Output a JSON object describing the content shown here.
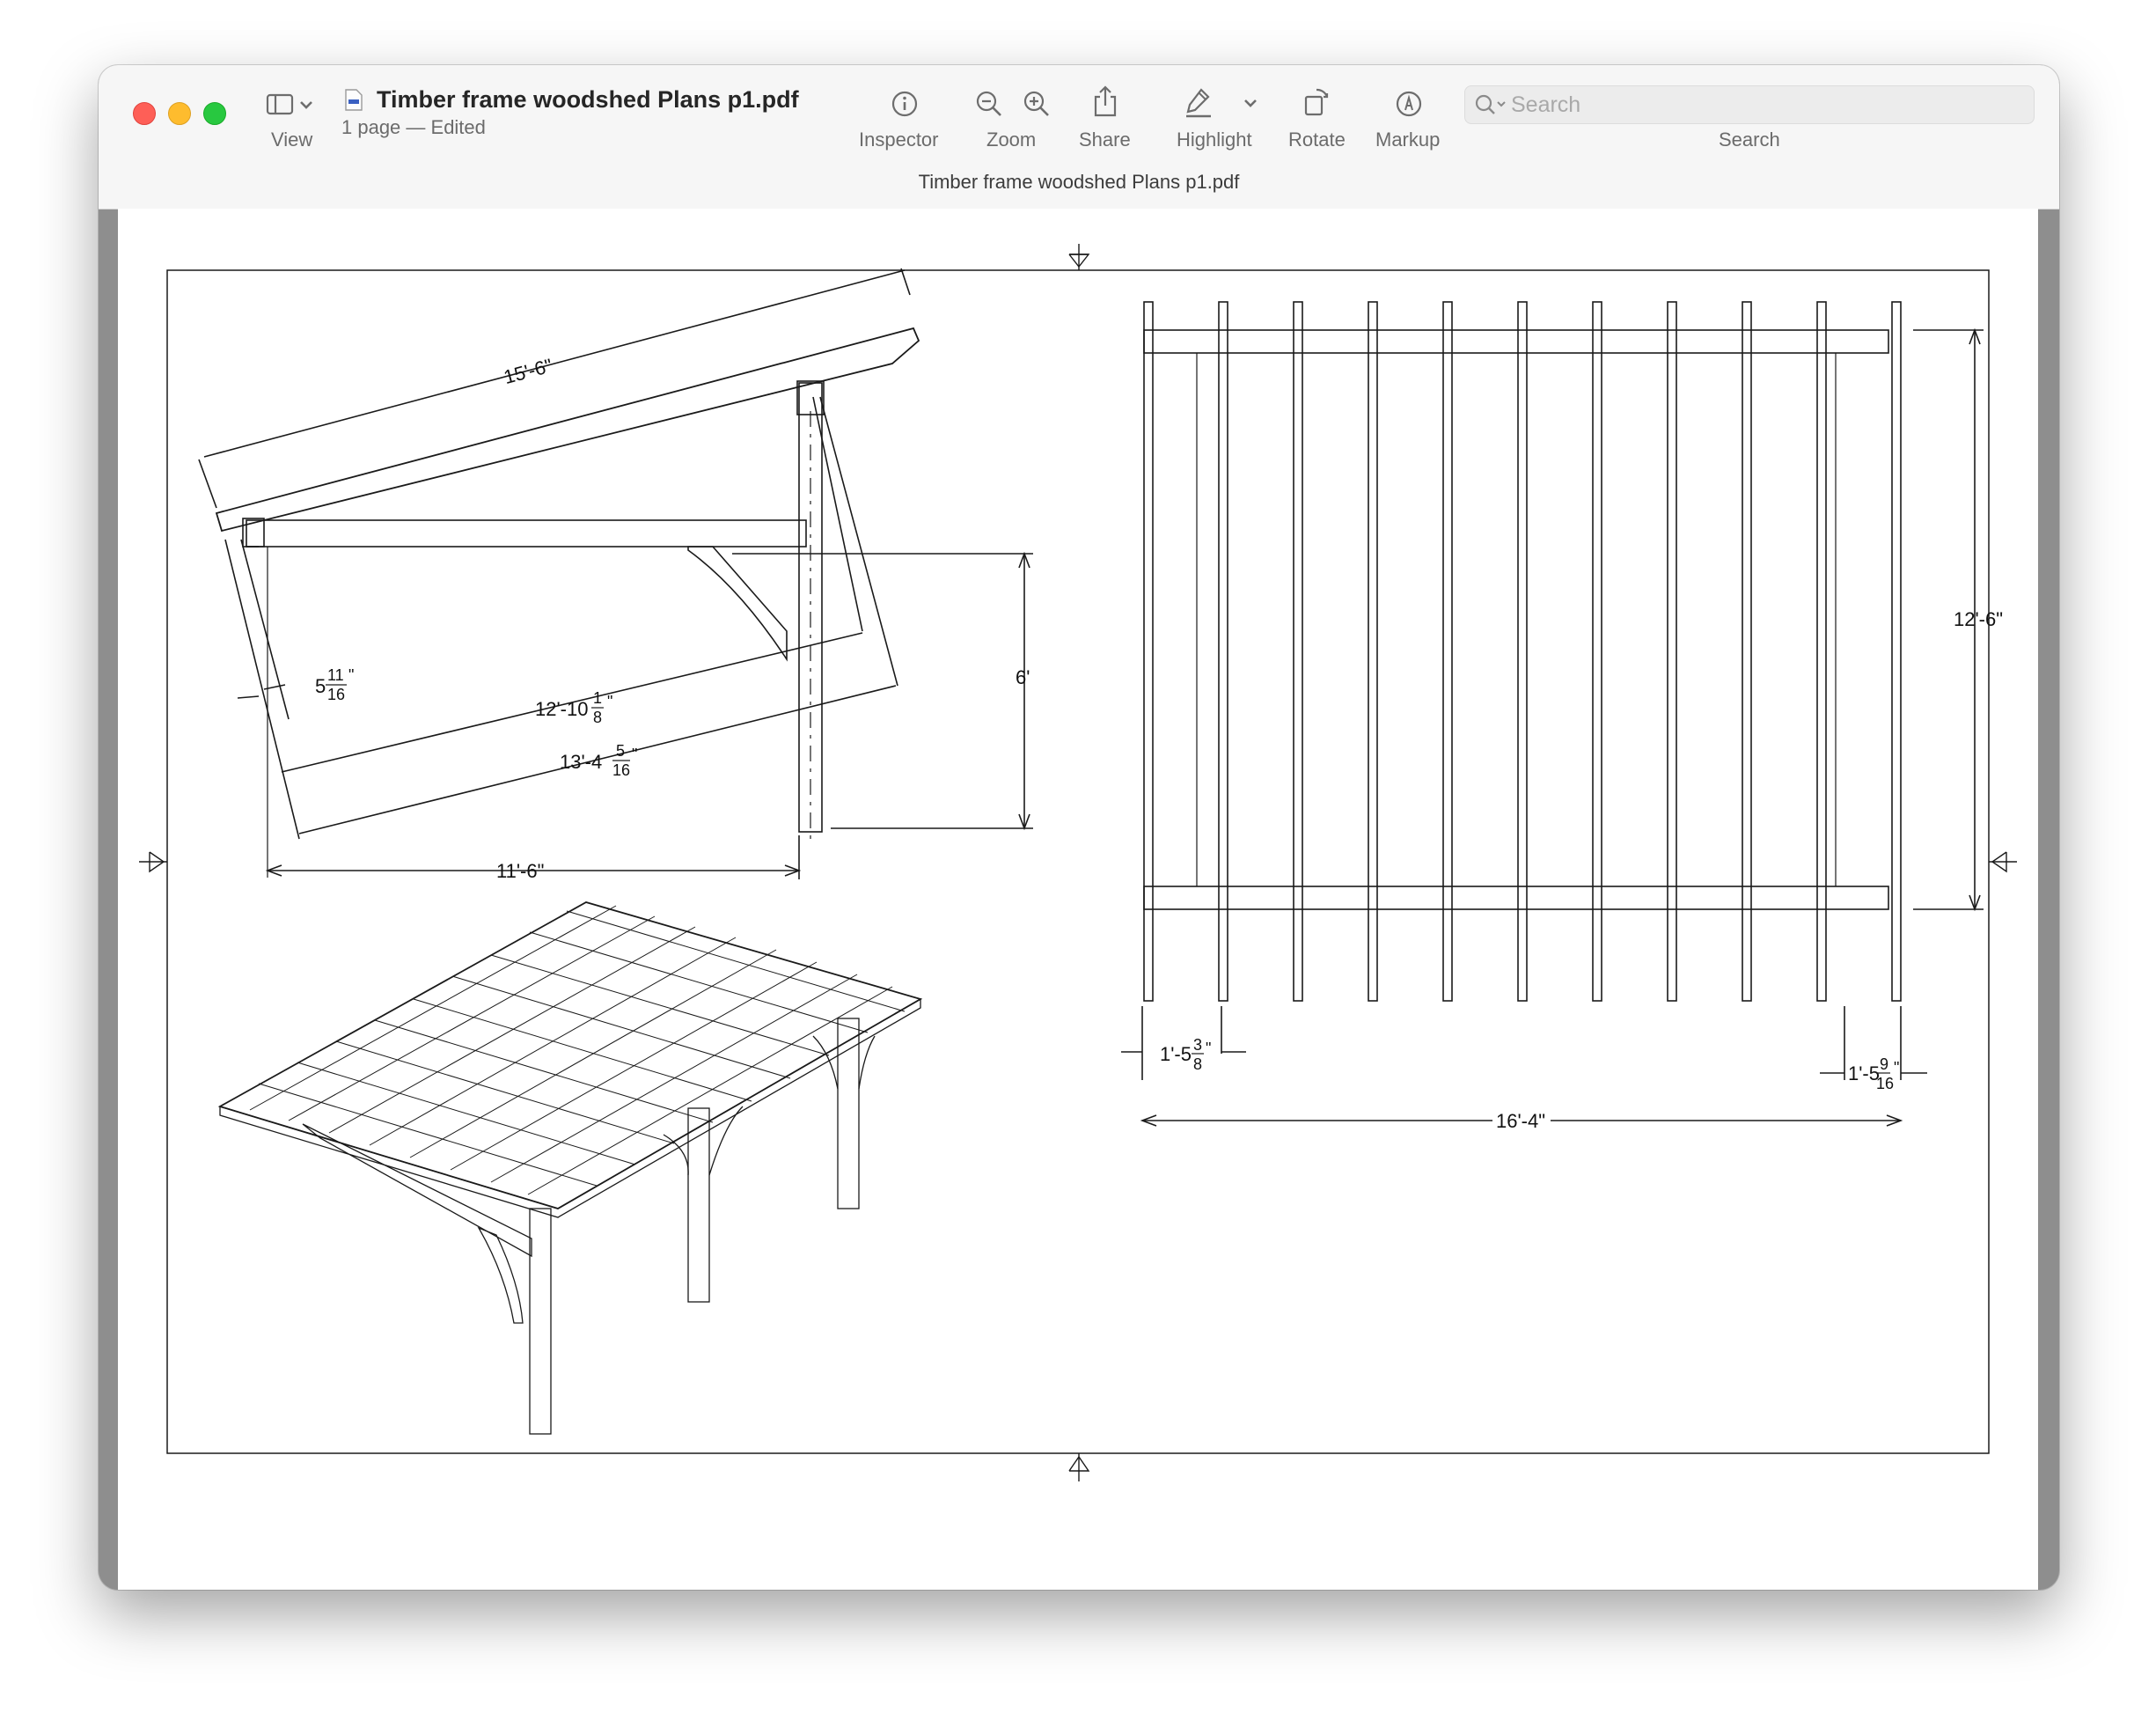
{
  "window": {
    "document_title": "Timber frame woodshed Plans p1.pdf",
    "document_subtitle": "1 page — Edited",
    "window_title": "Timber frame woodshed Plans p1.pdf"
  },
  "toolbar": {
    "view_label": "View",
    "inspector_label": "Inspector",
    "zoom_label": "Zoom",
    "share_label": "Share",
    "highlight_label": "Highlight",
    "rotate_label": "Rotate",
    "markup_label": "Markup",
    "search_label": "Search",
    "search_placeholder": "Search"
  },
  "drawing": {
    "side_view": {
      "rafter_length": "15'-6\"",
      "inset": "5",
      "inset_num": "11",
      "inset_den": "16",
      "brace_span_1": "12'-10",
      "brace_span_1_num": "1",
      "brace_span_1_den": "8",
      "brace_span_2": "13'-4",
      "brace_span_2_num": "5",
      "brace_span_2_den": "16",
      "post_height": "6'",
      "base_width": "11'-6\""
    },
    "plan_view": {
      "depth": "12'-6\"",
      "left_spacing": "1'-5",
      "left_spacing_num": "3",
      "left_spacing_den": "8",
      "right_spacing": "1'-5",
      "right_spacing_num": "9",
      "right_spacing_den": "16",
      "total_width": "16'-4\""
    }
  },
  "icons": {
    "sidebar": "sidebar-toggle-icon",
    "inspector": "info-circle-icon",
    "zoom_out": "zoom-out-icon",
    "zoom_in": "zoom-in-icon",
    "share": "share-icon",
    "highlight": "highlighter-icon",
    "rotate": "rotate-icon",
    "markup": "markup-pen-icon",
    "search": "magnifier-icon"
  }
}
